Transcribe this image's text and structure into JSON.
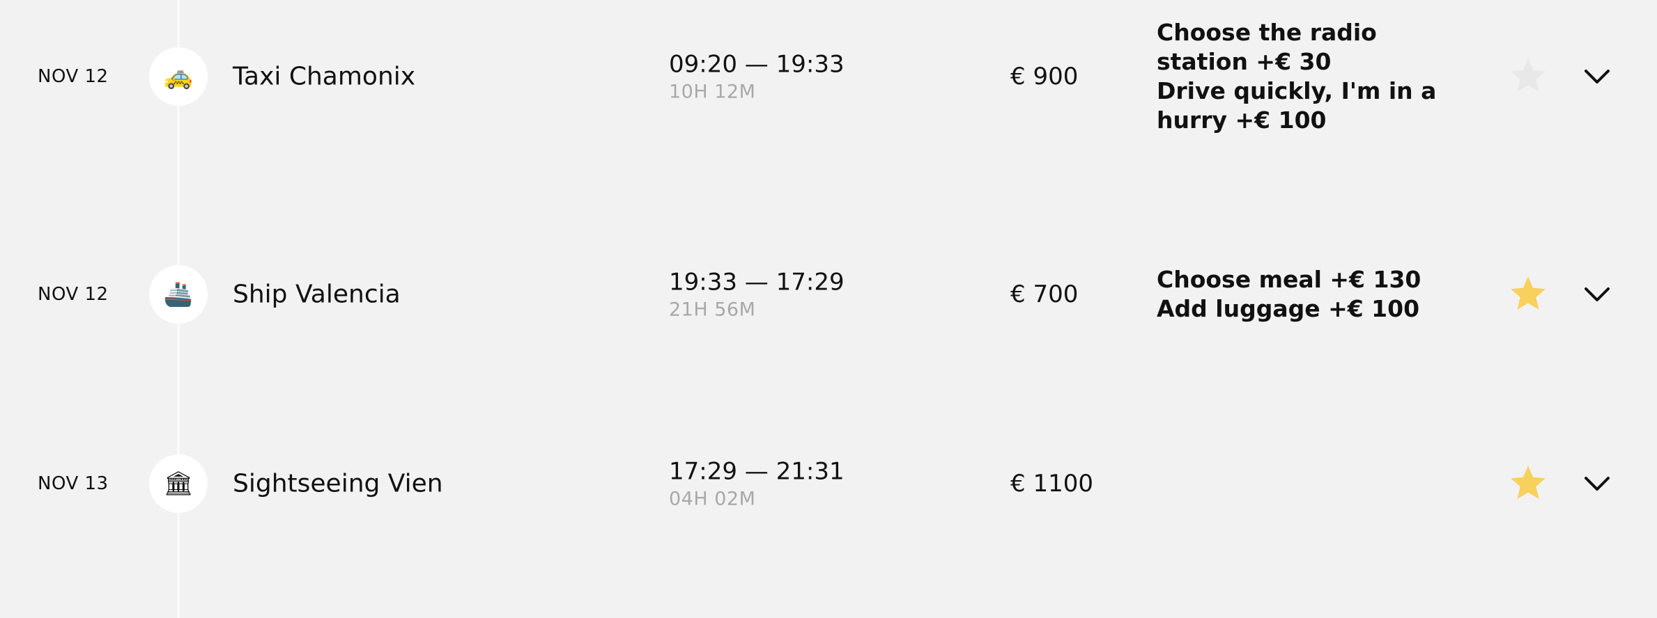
{
  "colors": {
    "background": "#f2f2f2",
    "timeline": "#fafafa",
    "icon_circle": "#ffffff",
    "star_active": "#f7d15c",
    "star_inactive": "#e8e8e8",
    "duration_text": "#a8a8a8"
  },
  "trips": [
    {
      "date": "NOV 12",
      "icon": "taxi-icon",
      "icon_glyph": "🚕",
      "title": "Taxi Chamonix",
      "time_range": "09:20 — 19:33",
      "duration": "10H 12M",
      "price": "€ 900",
      "extras": [
        "Choose the radio station +€  30",
        "Drive quickly, I'm in a hurry +€  100"
      ],
      "favorite": false
    },
    {
      "date": "NOV 12",
      "icon": "ship-icon",
      "icon_glyph": "🚢",
      "title": "Ship Valencia",
      "time_range": "19:33 — 17:29",
      "duration": "21H 56M",
      "price": "€ 700",
      "extras": [
        "Choose meal +€  130",
        "Add luggage +€  100"
      ],
      "favorite": true
    },
    {
      "date": "NOV 13",
      "icon": "museum-icon",
      "icon_glyph": "🏛",
      "title": "Sightseeing Vien",
      "time_range": "17:29 — 21:31",
      "duration": "04H 02M",
      "price": "€ 1100",
      "extras": [],
      "favorite": true
    }
  ]
}
